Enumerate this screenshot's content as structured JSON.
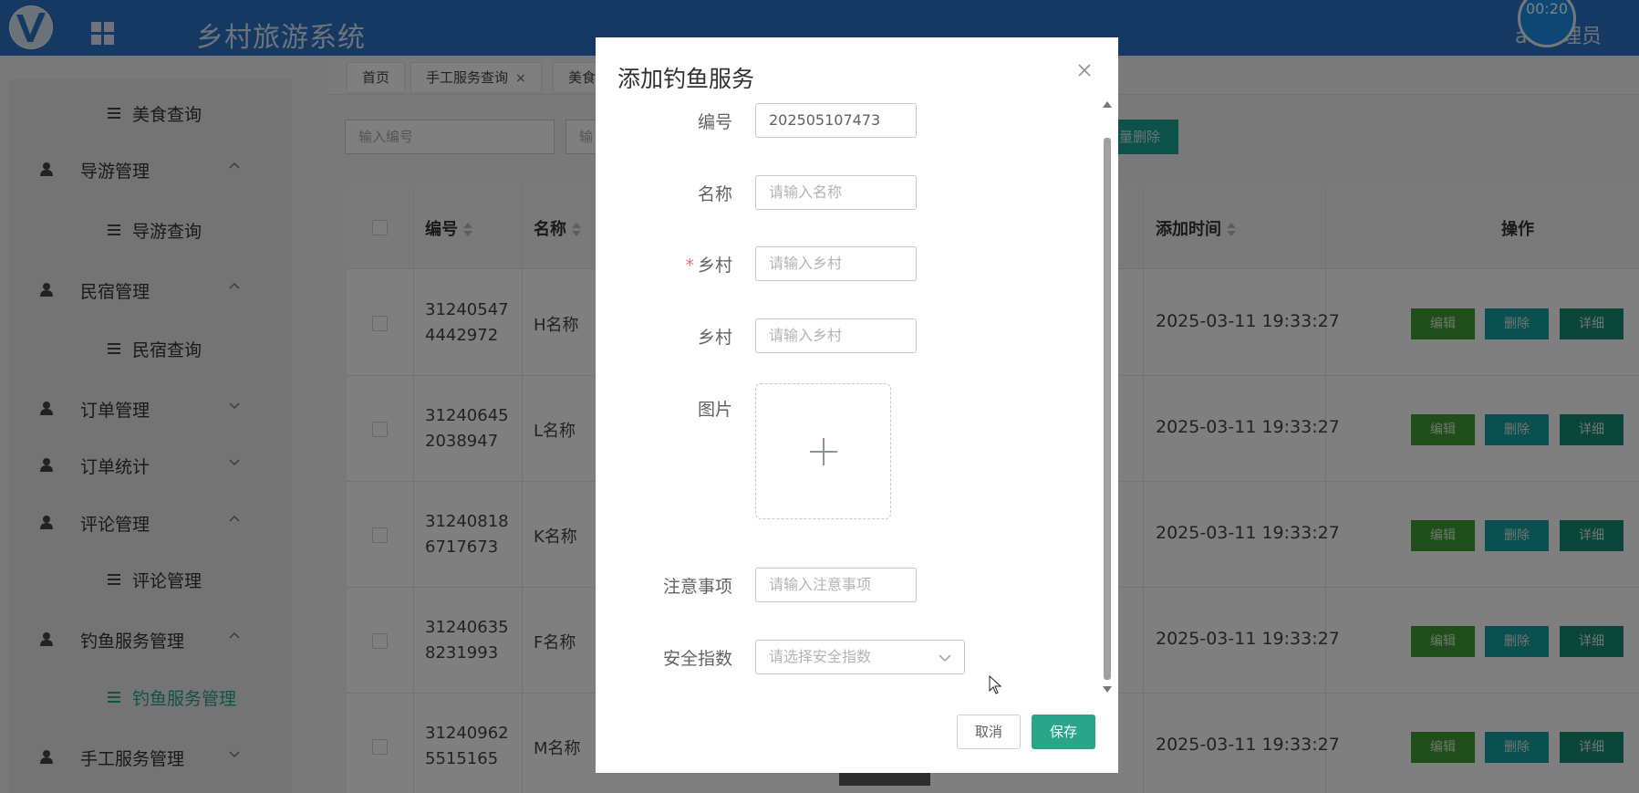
{
  "header": {
    "title": "乡村旅游系统",
    "user": "a      [管理员",
    "timer": "00:20"
  },
  "sidebar": {
    "items": [
      {
        "label": "美食查询",
        "type": "sub"
      },
      {
        "label": "导游管理",
        "type": "group",
        "expanded": true
      },
      {
        "label": "导游查询",
        "type": "sub"
      },
      {
        "label": "民宿管理",
        "type": "group",
        "expanded": true
      },
      {
        "label": "民宿查询",
        "type": "sub"
      },
      {
        "label": "订单管理",
        "type": "group",
        "expanded": false
      },
      {
        "label": "订单统计",
        "type": "group",
        "expanded": false
      },
      {
        "label": "评论管理",
        "type": "group",
        "expanded": true
      },
      {
        "label": "评论管理",
        "type": "sub"
      },
      {
        "label": "钓鱼服务管理",
        "type": "group",
        "expanded": true
      },
      {
        "label": "钓鱼服务管理",
        "type": "sub",
        "active": true
      },
      {
        "label": "手工服务管理",
        "type": "group",
        "expanded": false
      }
    ]
  },
  "tabs": [
    {
      "label": "首页"
    },
    {
      "label": "手工服务查询",
      "close": "×"
    },
    {
      "label": "美食"
    }
  ],
  "search": {
    "id_placeholder": "输入编号",
    "second_placeholder": "输",
    "batch_delete": "量删除"
  },
  "table": {
    "headers": {
      "id": "编号",
      "name": "名称",
      "time": "添加时间",
      "ops": "操作"
    },
    "rows": [
      {
        "id": "312405474442972",
        "name": "H名称",
        "time": "2025-03-11 19:33:27"
      },
      {
        "id": "312406452038947",
        "name": "L名称",
        "time": "2025-03-11 19:33:27"
      },
      {
        "id": "312408186717673",
        "name": "K名称",
        "time": "2025-03-11 19:33:27"
      },
      {
        "id": "312406358231993",
        "name": "F名称",
        "time": "2025-03-11 19:33:27"
      },
      {
        "id": "312409625515165",
        "name": "M名称",
        "time": "2025-03-11 19:33:27"
      }
    ],
    "actions": {
      "edit": "编辑",
      "delete": "删除",
      "detail": "详细"
    }
  },
  "dialog": {
    "title": "添加钓鱼服务",
    "fields": {
      "id_label": "编号",
      "id_value": "202505107473",
      "name_label": "名称",
      "name_placeholder": "请输入名称",
      "village_label": "乡村",
      "village_placeholder": "请输入乡村",
      "village2_label": "乡村",
      "village2_placeholder": "请输入乡村",
      "image_label": "图片",
      "notes_label": "注意事项",
      "notes_placeholder": "请输入注意事项",
      "safety_label": "安全指数",
      "safety_placeholder": "请选择安全指数"
    },
    "required_mark": "*",
    "cancel": "取消",
    "save": "保存"
  },
  "colors": {
    "header": "#2a72c6",
    "primary": "#2aa589",
    "edit": "#3f9c34",
    "delete": "#16a0a0",
    "detail": "#178c77"
  }
}
